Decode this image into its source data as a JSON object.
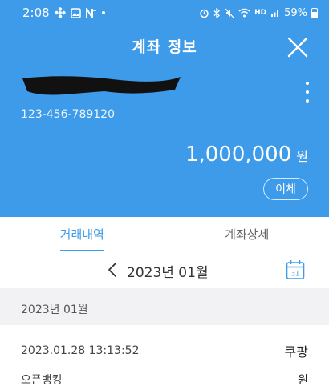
{
  "status_bar": {
    "time": "2:08",
    "network_label": "HD",
    "battery": "59%"
  },
  "header": {
    "title": "계좌 정보",
    "account_number": "123-456-789120",
    "balance_amount": "1,000,000",
    "balance_unit": "원",
    "transfer_label": "이체"
  },
  "tabs": [
    {
      "label": "거래내역",
      "active": true
    },
    {
      "label": "계좌상세",
      "active": false
    }
  ],
  "month_nav": {
    "label": "2023년 01월",
    "calendar_day": "31"
  },
  "section": {
    "label": "2023년 01월"
  },
  "transactions": [
    {
      "datetime": "2023.01.28 13:13:52",
      "merchant": "쿠팡",
      "channel": "오픈뱅킹",
      "amount_unit": "원"
    }
  ],
  "colors": {
    "accent": "#3d9be9",
    "background": "#f2f2f4"
  },
  "icons": [
    "close-icon",
    "more-vert-icon",
    "chevron-left-icon",
    "calendar-icon",
    "battery-icon",
    "wifi-icon",
    "signal-icon"
  ]
}
